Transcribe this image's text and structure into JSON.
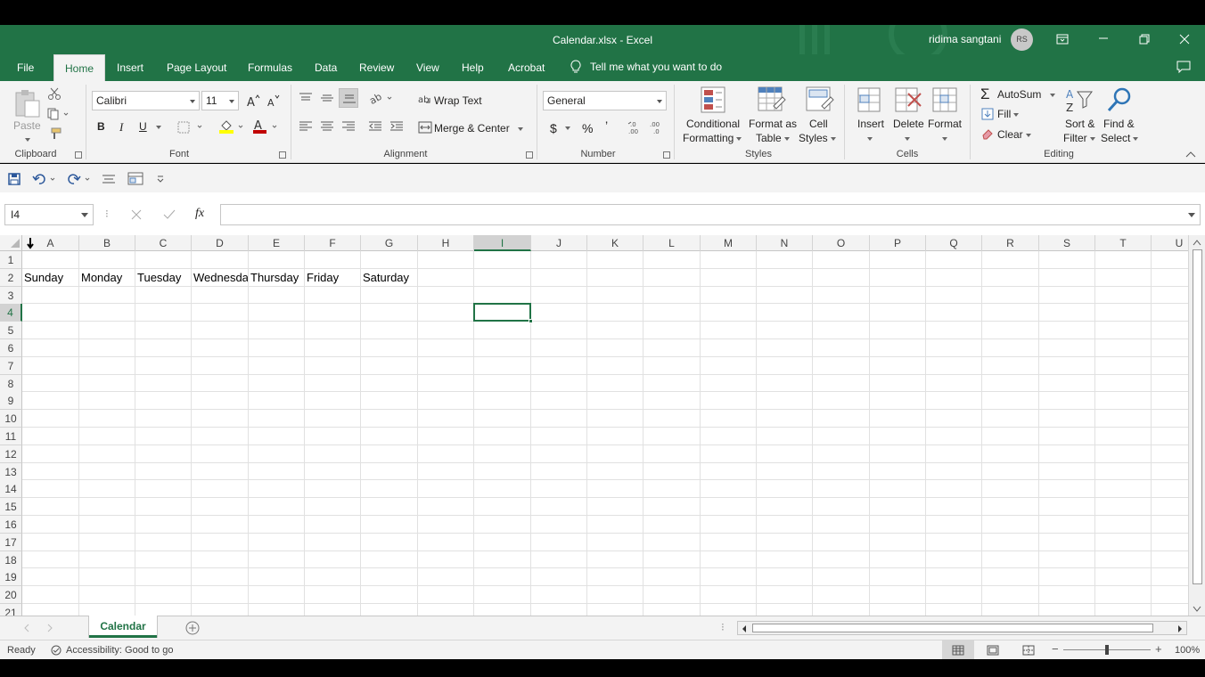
{
  "window": {
    "title": "Calendar.xlsx  -  Excel",
    "user_name": "ridima sangtani",
    "user_initials": "RS"
  },
  "tabs": [
    "File",
    "Home",
    "Insert",
    "Page Layout",
    "Formulas",
    "Data",
    "Review",
    "View",
    "Help",
    "Acrobat"
  ],
  "active_tab": "Home",
  "tell_me": "Tell me what you want to do",
  "ribbon": {
    "clipboard": {
      "label": "Clipboard",
      "paste": "Paste"
    },
    "font": {
      "label": "Font",
      "name": "Calibri",
      "size": "11",
      "bold": "B",
      "italic": "I",
      "underline": "U"
    },
    "alignment": {
      "label": "Alignment",
      "wrap_text": "Wrap Text",
      "merge_center": "Merge & Center"
    },
    "number": {
      "label": "Number",
      "format": "General",
      "currency": "$",
      "percent": "%",
      "comma": "’"
    },
    "styles": {
      "label": "Styles",
      "conditional_1": "Conditional",
      "conditional_2": "Formatting",
      "format_table_1": "Format as",
      "format_table_2": "Table",
      "cell_styles_1": "Cell",
      "cell_styles_2": "Styles"
    },
    "cells": {
      "label": "Cells",
      "insert": "Insert",
      "delete": "Delete",
      "format": "Format"
    },
    "editing": {
      "label": "Editing",
      "autosum": "AutoSum",
      "fill": "Fill",
      "clear": "Clear",
      "sort_1": "Sort &",
      "sort_2": "Filter",
      "find_1": "Find &",
      "find_2": "Select"
    }
  },
  "formula_bar": {
    "name_box": "I4",
    "fx": "fx",
    "value": ""
  },
  "columns": [
    "A",
    "B",
    "C",
    "D",
    "E",
    "F",
    "G",
    "H",
    "I",
    "J",
    "K",
    "L",
    "M",
    "N",
    "O",
    "P",
    "Q",
    "R",
    "S",
    "T",
    "U"
  ],
  "rows": [
    "1",
    "2",
    "3",
    "4",
    "5",
    "6",
    "7",
    "8",
    "9",
    "10",
    "11",
    "12",
    "13",
    "14",
    "15",
    "16",
    "17",
    "18",
    "19",
    "20",
    "21"
  ],
  "cells": {
    "A2": "Sunday",
    "B2": "Monday",
    "C2": "Tuesday",
    "D2": "Wednesday",
    "E2": "Thursday",
    "F2": "Friday",
    "G2": "Saturday"
  },
  "selected_cell": "I4",
  "sheets": [
    "Calendar"
  ],
  "active_sheet": "Calendar",
  "status": {
    "ready": "Ready",
    "accessibility": "Accessibility: Good to go",
    "zoom": "100%"
  },
  "colors": {
    "excel_green": "#217346",
    "ribbon_bg": "#f3f3f3"
  }
}
